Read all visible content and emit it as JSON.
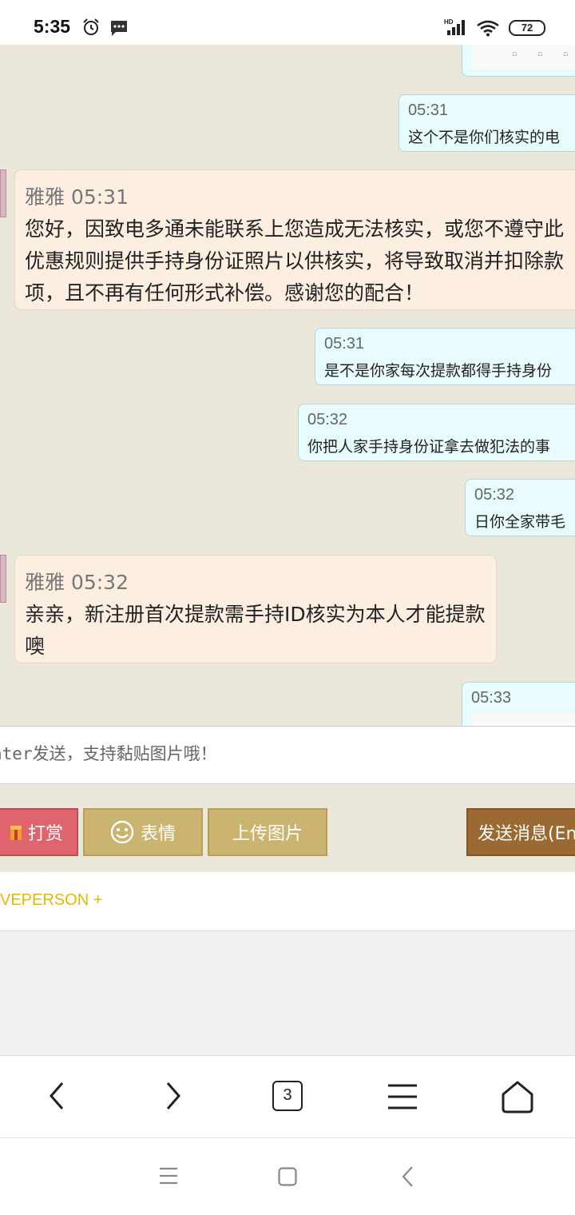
{
  "status_bar": {
    "time": "5:35",
    "battery": "72",
    "network": "HD"
  },
  "chat": {
    "messages": [
      {
        "dir": "out",
        "time": "05:31",
        "text": "这个不是你们核实的电"
      },
      {
        "dir": "in",
        "sender": "雅雅 05:31",
        "text": "您好，因致电多通未能联系上您造成无法核实，或您不遵守此优惠规则提供手持身份证照片以供核实，将导致取消并扣除款项，且不再有任何形式补偿。感谢您的配合！"
      },
      {
        "dir": "out",
        "time": "05:31",
        "text": "是不是你家每次提款都得手持身份"
      },
      {
        "dir": "out",
        "time": "05:32",
        "text": "你把人家手持身份证拿去做犯法的事"
      },
      {
        "dir": "out",
        "time": "05:32",
        "text": "日你全家带毛"
      },
      {
        "dir": "in",
        "sender": "雅雅 05:32",
        "text": "亲亲，新注册首次提款需手持ID核实为本人才能提款噢"
      },
      {
        "dir": "out",
        "time": "05:33",
        "text": ""
      }
    ]
  },
  "input": {
    "placeholder": "nter发送，支持黏贴图片哦！"
  },
  "toolbar": {
    "reward_label": "打赏",
    "emoji_label": "表情",
    "upload_label": "上传图片",
    "send_label": "发送消息(En"
  },
  "brand": {
    "text": "VEPERSON +"
  },
  "browser_nav": {
    "tab_count": "3"
  },
  "colors": {
    "chat_bg": "#ebe7da",
    "outgoing_bubble": "#e9fcfd",
    "incoming_bubble": "#fdeee2",
    "reward_button": "#e0646e",
    "tool_button": "#cbb46f",
    "send_button": "#9b6a33",
    "brand_text": "#e5b800"
  },
  "icons": {
    "alarm": "alarm-icon",
    "message": "message-icon",
    "signal": "signal-icon",
    "wifi": "wifi-icon",
    "gift": "gift-icon",
    "smiley": "smiley-icon",
    "back": "chevron-left-icon",
    "forward": "chevron-right-icon",
    "menu": "menu-icon",
    "home": "home-icon"
  }
}
